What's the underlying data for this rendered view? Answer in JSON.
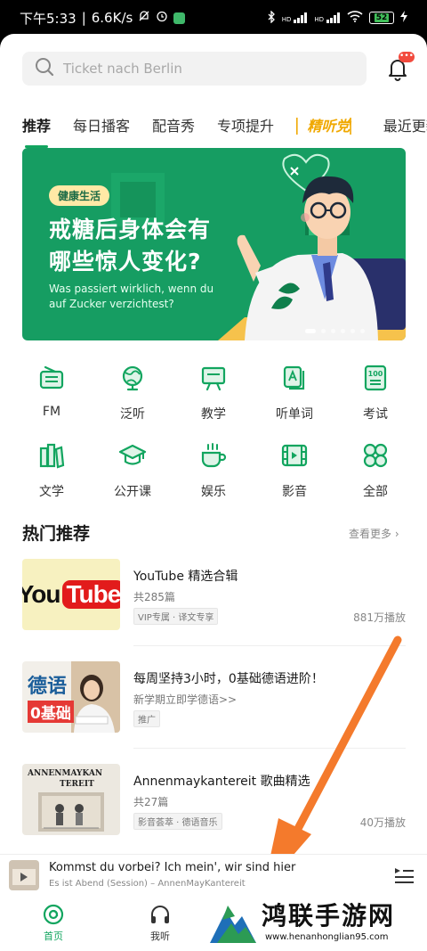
{
  "status_bar": {
    "time": "下午5:33",
    "speed": "6.6K/s",
    "net1": "HD",
    "net2": "HD",
    "battery": "52"
  },
  "search": {
    "placeholder": "Ticket nach Berlin"
  },
  "notification": {
    "badge": "•••"
  },
  "tabs": [
    {
      "label": "推荐",
      "active": true
    },
    {
      "label": "每日播客"
    },
    {
      "label": "配音秀"
    },
    {
      "label": "专项提升"
    },
    {
      "label": "精听党",
      "special": true
    },
    {
      "label": "最近更新"
    }
  ],
  "banner": {
    "tag": "健康生活",
    "line1": "戒糖后身体会有",
    "line2": "哪些惊人变化?",
    "subtitle": "Was passiert wirklich, wenn du auf Zucker verzichtest?"
  },
  "categories": [
    {
      "label": "FM",
      "icon": "radio-icon"
    },
    {
      "label": "泛听",
      "icon": "globe-icon"
    },
    {
      "label": "教学",
      "icon": "easel-icon"
    },
    {
      "label": "听单词",
      "icon": "flashcard-icon"
    },
    {
      "label": "考试",
      "icon": "exam-icon"
    },
    {
      "label": "文学",
      "icon": "books-icon"
    },
    {
      "label": "公开课",
      "icon": "graduation-cap-icon"
    },
    {
      "label": "娱乐",
      "icon": "coffee-cup-icon"
    },
    {
      "label": "影音",
      "icon": "film-icon"
    },
    {
      "label": "全部",
      "icon": "four-leaf-icon"
    }
  ],
  "section": {
    "title": "热门推荐",
    "more": "查看更多"
  },
  "items": [
    {
      "title": "YouTube 精选合辑",
      "sub": "共285篇",
      "badge": "VIP专属 · 译文专享",
      "plays": "881万播放",
      "thumb_text1": "You",
      "thumb_text2": "Tube"
    },
    {
      "title": "每周坚持3小时，0基础德语进阶！",
      "sub": "新学期立即学德语>>",
      "badge": "推广",
      "plays": "",
      "thumb_text1": "德语",
      "thumb_text2": "0基础"
    },
    {
      "title": "Annenmaykantereit 歌曲精选",
      "sub": "共27篇",
      "badge": "影音荟萃 · 德语音乐",
      "plays": "40万播放",
      "thumb_text1": "ANNENMAYKAN",
      "thumb_text2": "TEREIT"
    }
  ],
  "player": {
    "title": "Kommst du vorbei? Ich mein', wir sind hier",
    "subtitle": "Es ist Abend (Session) – AnnenMayKantereit"
  },
  "nav": [
    {
      "label": "首页",
      "active": true
    },
    {
      "label": "我听"
    }
  ],
  "watermark": {
    "text": "鸿联手游网",
    "url": "www.henanhonglian95.com"
  },
  "colors": {
    "accent": "#12a55f",
    "banner": "#169d62",
    "arrow": "#f47a2c",
    "special_tab": "#f0a800"
  }
}
